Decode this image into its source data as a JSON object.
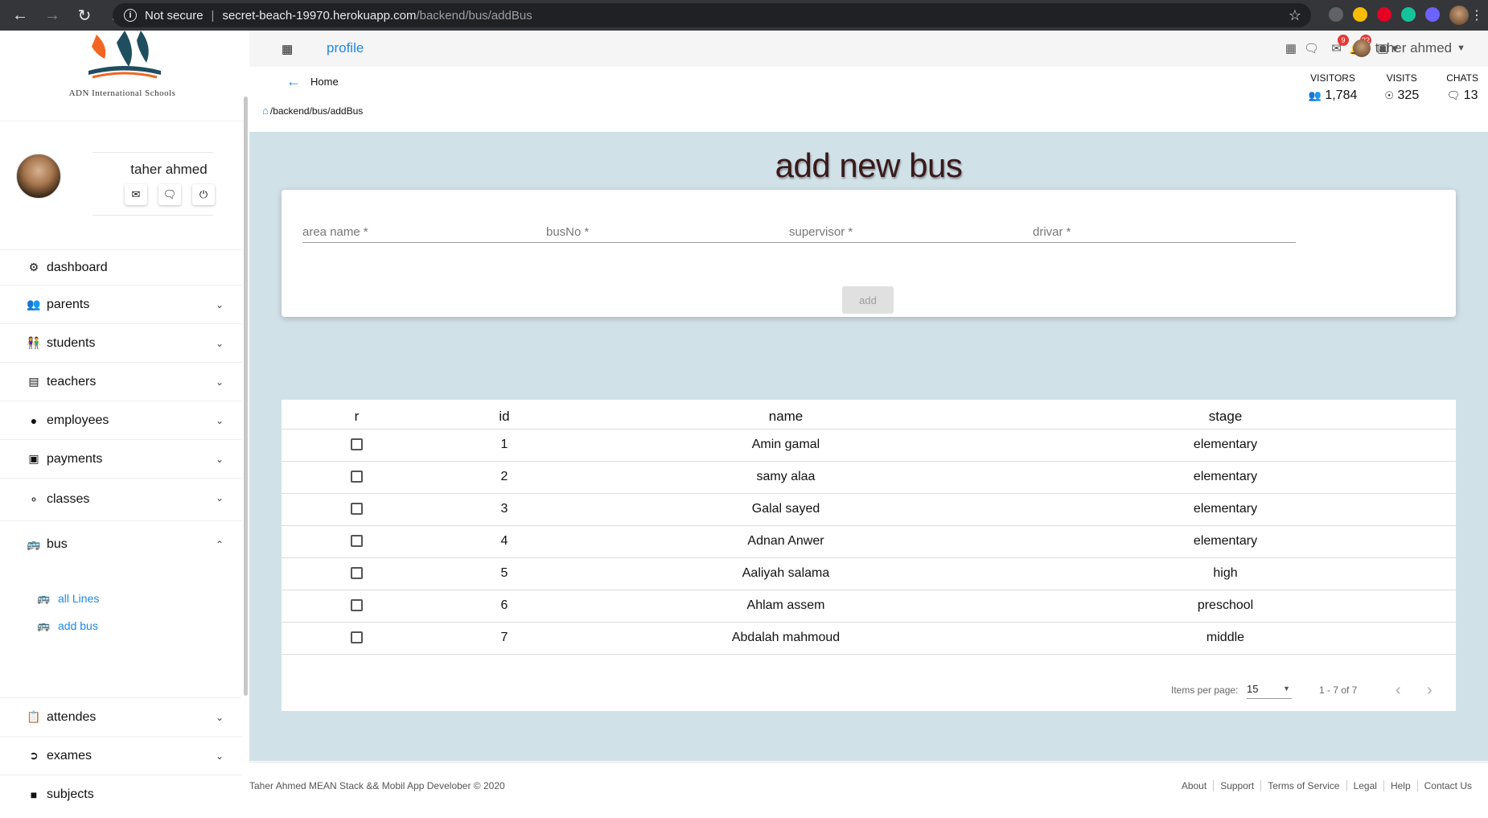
{
  "browser": {
    "security_label": "Not secure",
    "url_host": "secret-beach-19970.herokuapp.com",
    "url_path": "/backend/bus/addBus"
  },
  "sidebar": {
    "logo_text": "ADN International Schools",
    "profile_name": "taher ahmed",
    "menu": [
      {
        "label": "dashboard",
        "icon": "gauge-icon"
      },
      {
        "label": "parents",
        "icon": "users-icon"
      },
      {
        "label": "students",
        "icon": "students-icon"
      },
      {
        "label": "teachers",
        "icon": "chalkboard-teacher-icon"
      },
      {
        "label": "employees",
        "icon": "user-icon"
      },
      {
        "label": "payments",
        "icon": "wallet-icon"
      },
      {
        "label": "classes",
        "icon": "lightbulb-icon"
      },
      {
        "label": "bus",
        "icon": "bus-icon"
      },
      {
        "label": "attendes",
        "icon": "clipboard-icon"
      },
      {
        "label": "exames",
        "icon": "file-export-icon"
      },
      {
        "label": "subjects",
        "icon": "book-icon"
      }
    ],
    "bus_submenu": [
      {
        "label": "all Lines",
        "icon": "bus-icon"
      },
      {
        "label": "add bus",
        "icon": "bus-icon"
      }
    ]
  },
  "topbar": {
    "profile_link": "profile",
    "mail_badge": "9",
    "bell_badge": "22",
    "user_name": "taher ahmed"
  },
  "header": {
    "home_label": "Home",
    "breadcrumb": "/backend/bus/addBus",
    "stats": [
      {
        "label": "VISITORS",
        "value": "1,784",
        "icon": "users-icon"
      },
      {
        "label": "VISITS",
        "value": "325",
        "icon": "globe-icon"
      },
      {
        "label": "CHATS",
        "value": "13",
        "icon": "comments-icon"
      }
    ]
  },
  "main": {
    "title": "add new bus",
    "fields": {
      "area_name": "area name *",
      "bus_no": "busNo *",
      "supervisor": "supervisor *",
      "drivar": "drivar *"
    },
    "add_label": "add"
  },
  "table": {
    "headers": [
      "r",
      "id",
      "name",
      "stage"
    ],
    "rows": [
      {
        "id": "1",
        "name": "Amin gamal",
        "stage": "elementary"
      },
      {
        "id": "2",
        "name": "samy alaa",
        "stage": "elementary"
      },
      {
        "id": "3",
        "name": "Galal sayed",
        "stage": "elementary"
      },
      {
        "id": "4",
        "name": "Adnan Anwer",
        "stage": "elementary"
      },
      {
        "id": "5",
        "name": "Aaliyah salama",
        "stage": "high"
      },
      {
        "id": "6",
        "name": "Ahlam assem",
        "stage": "preschool"
      },
      {
        "id": "7",
        "name": "Abdalah mahmoud",
        "stage": "middle"
      }
    ],
    "paginator": {
      "items_per_page_label": "Items per page:",
      "page_size": "15",
      "range": "1 - 7 of 7"
    }
  },
  "footer": {
    "copyright": "Taher Ahmed MEAN Stack && Mobil App Develober © 2020",
    "links": [
      "About",
      "Support",
      "Terms of Service",
      "Legal",
      "Help",
      "Contact Us"
    ]
  }
}
